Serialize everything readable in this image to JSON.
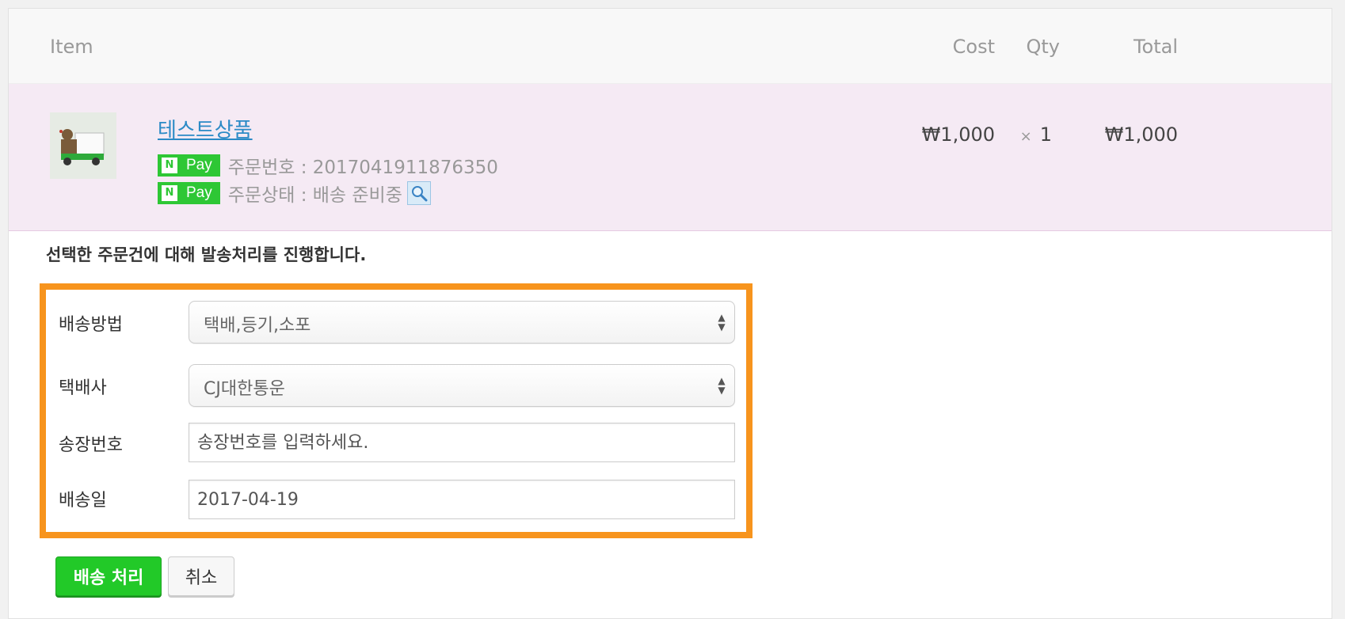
{
  "table": {
    "headers": {
      "item": "Item",
      "cost": "Cost",
      "qty": "Qty",
      "total": "Total"
    },
    "row": {
      "product_name": "테스트상품",
      "order_number_label": "주문번호 : 2017041911876350",
      "order_status_label": "주문상태 : 배송 준비중",
      "npay_badge": {
        "n": "N",
        "pay": "Pay"
      },
      "cost": "₩1,000",
      "qty_prefix": "×",
      "qty": "1",
      "total": "₩1,000"
    }
  },
  "shipping_form": {
    "instruction": "선택한 주문건에 대해 발송처리를 진행합니다.",
    "method_label": "배송방법",
    "method_value": "택배,등기,소포",
    "courier_label": "택배사",
    "courier_value": "CJ대한통운",
    "tracking_label": "송장번호",
    "tracking_placeholder": "송장번호를 입력하세요.",
    "date_label": "배송일",
    "date_value": "2017-04-19"
  },
  "buttons": {
    "submit": "배송 처리",
    "cancel": "취소"
  },
  "colors": {
    "highlight_border": "#f7941d",
    "primary_button": "#22c928",
    "row_bg": "#f5eaf4",
    "link": "#2b8ac6",
    "npay_green": "#2ec735"
  },
  "icons": {
    "thumbnail": "delivery-truck-image",
    "status_lookup": "magnifier-icon"
  }
}
